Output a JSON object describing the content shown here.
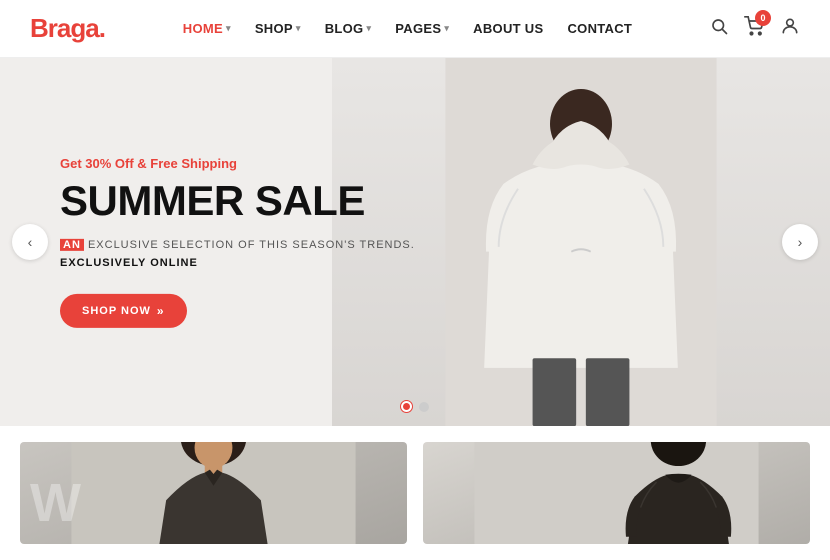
{
  "logo": {
    "text": "Braga",
    "dot": "."
  },
  "nav": {
    "items": [
      {
        "label": "HOME",
        "active": true,
        "hasDropdown": true
      },
      {
        "label": "SHOP",
        "active": false,
        "hasDropdown": true
      },
      {
        "label": "BLOG",
        "active": false,
        "hasDropdown": true
      },
      {
        "label": "PAGES",
        "active": false,
        "hasDropdown": true
      },
      {
        "label": "ABOUT US",
        "active": false,
        "hasDropdown": false
      },
      {
        "label": "CONTACT",
        "active": false,
        "hasDropdown": false
      }
    ]
  },
  "cart": {
    "count": "0"
  },
  "hero": {
    "promo": "Get 30% Off & Free Shipping",
    "title": "SUMMER SALE",
    "sub_an": "AN",
    "sub_rest": " EXCLUSIVE SELECTION OF THIS SEASON'S TRENDS.",
    "sub_line2": "EXCLUSIVELY ONLINE",
    "btn_label": "SHOP NOW",
    "btn_arrow": "»"
  },
  "slider": {
    "dots": [
      {
        "active": true
      },
      {
        "active": false
      }
    ],
    "prev_arrow": "‹",
    "next_arrow": "›"
  },
  "bottom": {
    "card1_letter": "W",
    "card2_letter": ""
  }
}
